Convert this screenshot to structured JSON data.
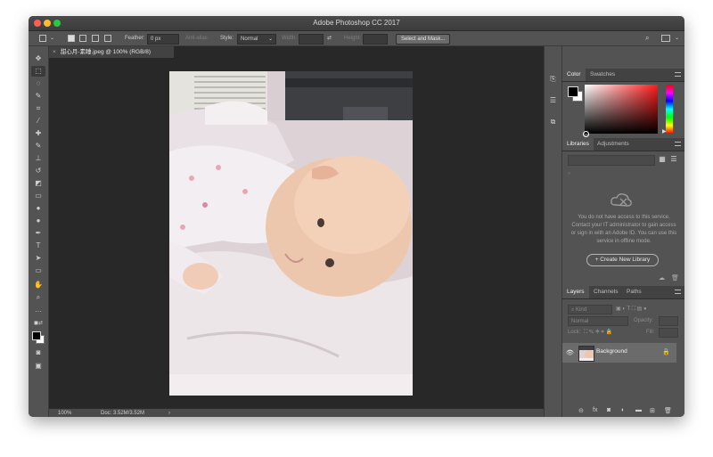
{
  "window": {
    "title": "Adobe Photoshop CC 2017"
  },
  "options": {
    "feather_label": "Feather:",
    "feather_value": "0 px",
    "antialias_label": "Anti-alias",
    "style_label": "Style:",
    "style_value": "Normal",
    "width_label": "Width:",
    "height_label": "Height:",
    "select_mask_label": "Select and Mask..."
  },
  "document": {
    "tab_title": "甜心月-素睡.jpeg @ 100% (RGB/8)",
    "status_zoom": "100%",
    "status_doc": "Doc: 3.52M/3.52M"
  },
  "tools": [
    {
      "icon": "move-tool-icon",
      "glyph": "✥"
    },
    {
      "icon": "rectangular-marquee-tool-icon",
      "glyph": "⬚"
    },
    {
      "icon": "lasso-tool-icon",
      "glyph": "◌"
    },
    {
      "icon": "quick-selection-tool-icon",
      "glyph": "✎"
    },
    {
      "icon": "crop-tool-icon",
      "glyph": "⌗"
    },
    {
      "icon": "eyedropper-tool-icon",
      "glyph": "⁄"
    },
    {
      "icon": "healing-brush-tool-icon",
      "glyph": "✚"
    },
    {
      "icon": "brush-tool-icon",
      "glyph": "✎"
    },
    {
      "icon": "clone-stamp-tool-icon",
      "glyph": "⊥"
    },
    {
      "icon": "history-brush-tool-icon",
      "glyph": "↺"
    },
    {
      "icon": "eraser-tool-icon",
      "glyph": "◩"
    },
    {
      "icon": "gradient-tool-icon",
      "glyph": "▭"
    },
    {
      "icon": "blur-tool-icon",
      "glyph": "●"
    },
    {
      "icon": "dodge-tool-icon",
      "glyph": "●"
    },
    {
      "icon": "pen-tool-icon",
      "glyph": "✒"
    },
    {
      "icon": "type-tool-icon",
      "glyph": "T"
    },
    {
      "icon": "path-selection-tool-icon",
      "glyph": "➤"
    },
    {
      "icon": "rectangle-tool-icon",
      "glyph": "▭"
    },
    {
      "icon": "hand-tool-icon",
      "glyph": "✋"
    },
    {
      "icon": "zoom-tool-icon",
      "glyph": "⌕"
    },
    {
      "icon": "more-tools-icon",
      "glyph": "···"
    }
  ],
  "color_panel": {
    "tabs": [
      "Color",
      "Swatches"
    ],
    "foreground": "#000000",
    "background": "#ffffff"
  },
  "libraries": {
    "tabs": [
      "Libraries",
      "Adjustments"
    ],
    "message": "You do not have access to this service. Contact your IT administrator to gain access or sign in with an Adobe ID. You can use this service in offline mode.",
    "create_label": "+ Create New Library"
  },
  "layers": {
    "tabs": [
      "Layers",
      "Channels",
      "Paths"
    ],
    "kind_label": "Kind",
    "blend_mode": "Normal",
    "opacity_label": "Opacity:",
    "lock_label": "Lock:",
    "fill_label": "Fill:",
    "items": [
      {
        "name": "Background",
        "locked": true,
        "visible": true
      }
    ]
  }
}
